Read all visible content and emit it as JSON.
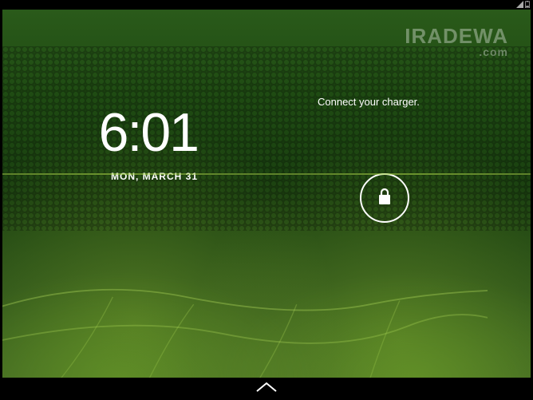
{
  "status": {
    "signal_icon": "signal-icon",
    "battery_icon": "battery-icon"
  },
  "watermark": {
    "main": "IRADEWA",
    "sub": ".com"
  },
  "clock": {
    "time": "6:01",
    "date": "MON, MARCH 31"
  },
  "notification": {
    "text": "Connect your charger."
  },
  "lock": {
    "icon": "lock-icon"
  },
  "nav": {
    "handle": "chevron-up-icon"
  }
}
